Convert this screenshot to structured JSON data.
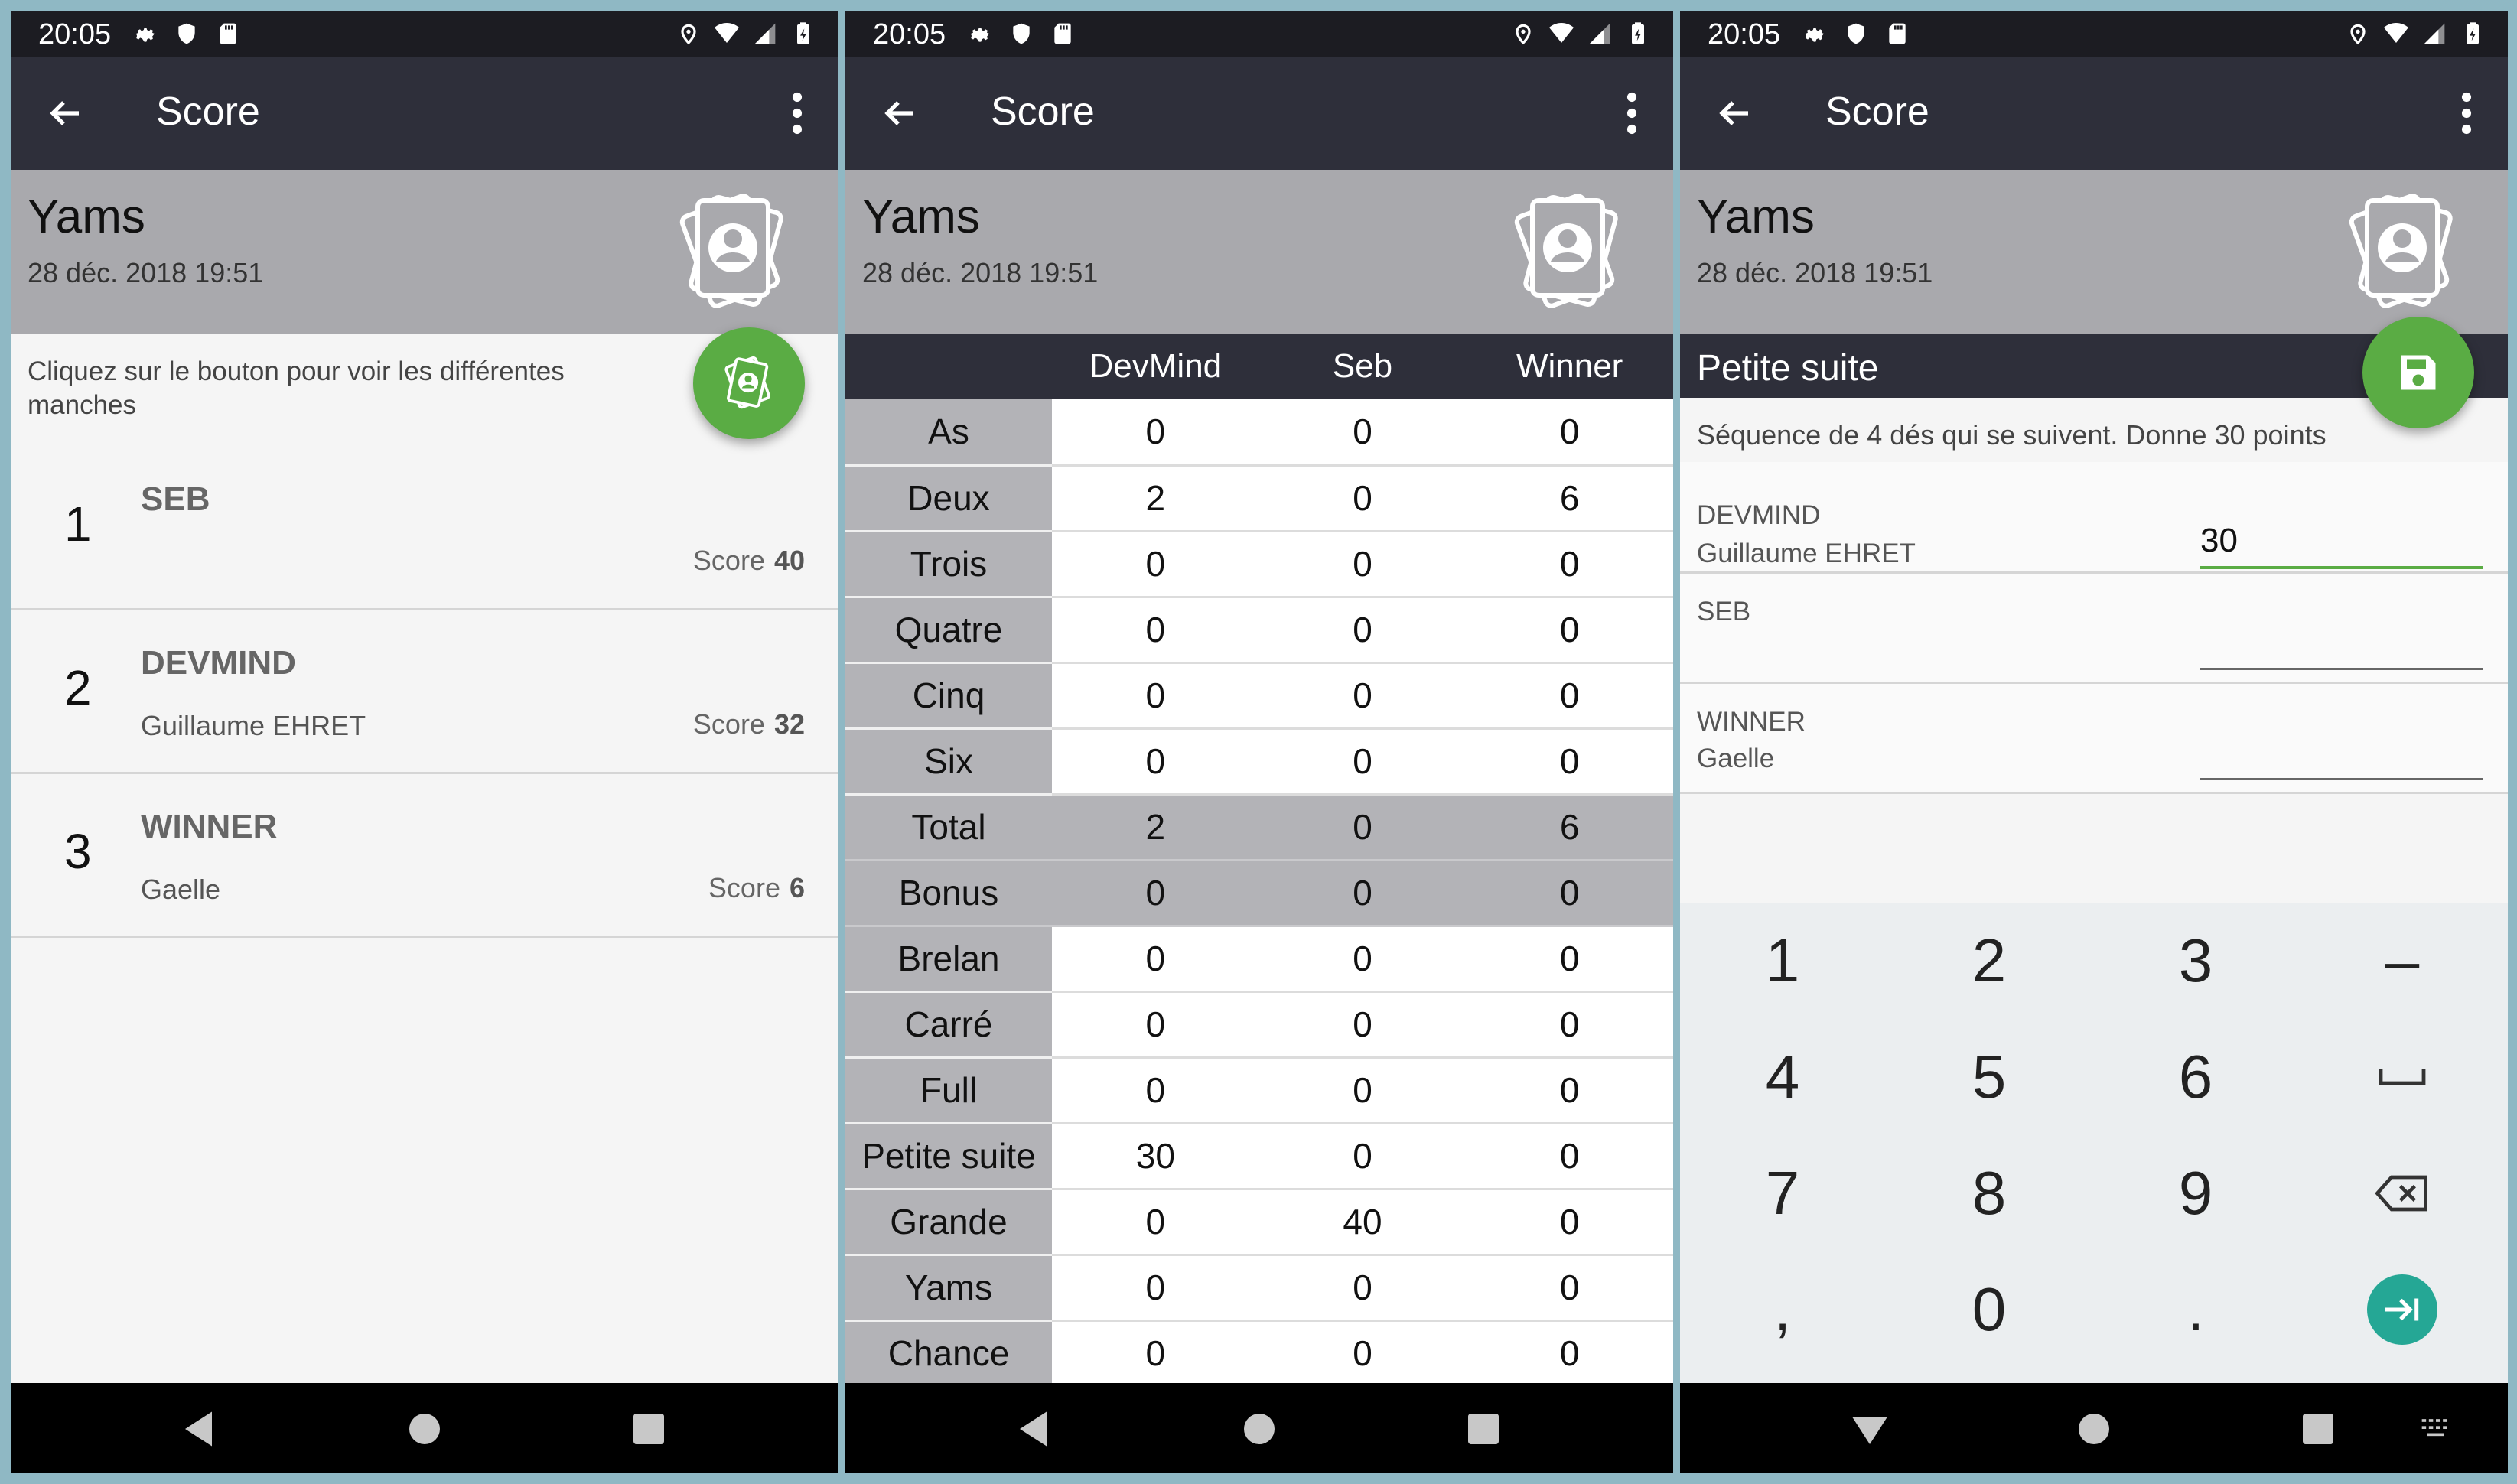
{
  "status": {
    "time": "20:05"
  },
  "appbar": {
    "title": "Score"
  },
  "game": {
    "name": "Yams",
    "date": "28 déc. 2018 19:51"
  },
  "ranking": {
    "hint": "Cliquez sur le bouton pour voir les différentes manches",
    "score_label": "Score",
    "items": [
      {
        "rank": "1",
        "name": "SEB",
        "subtitle": "",
        "score": "40"
      },
      {
        "rank": "2",
        "name": "DEVMIND",
        "subtitle": "Guillaume EHRET",
        "score": "32"
      },
      {
        "rank": "3",
        "name": "WINNER",
        "subtitle": "Gaelle",
        "score": "6"
      }
    ]
  },
  "table": {
    "headers": [
      "",
      "DevMind",
      "Seb",
      "Winner"
    ],
    "rows": [
      {
        "label": "As",
        "values": [
          "0",
          "0",
          "0"
        ]
      },
      {
        "label": "Deux",
        "values": [
          "2",
          "0",
          "6"
        ]
      },
      {
        "label": "Trois",
        "values": [
          "0",
          "0",
          "0"
        ]
      },
      {
        "label": "Quatre",
        "values": [
          "0",
          "0",
          "0"
        ]
      },
      {
        "label": "Cinq",
        "values": [
          "0",
          "0",
          "0"
        ]
      },
      {
        "label": "Six",
        "values": [
          "0",
          "0",
          "0"
        ]
      },
      {
        "label": "Total",
        "values": [
          "2",
          "0",
          "6"
        ]
      },
      {
        "label": "Bonus",
        "values": [
          "0",
          "0",
          "0"
        ]
      },
      {
        "label": "Brelan",
        "values": [
          "0",
          "0",
          "0"
        ]
      },
      {
        "label": "Carré",
        "values": [
          "0",
          "0",
          "0"
        ]
      },
      {
        "label": "Full",
        "values": [
          "0",
          "0",
          "0"
        ]
      },
      {
        "label": "Petite suite",
        "values": [
          "30",
          "0",
          "0"
        ]
      },
      {
        "label": "Grande",
        "values": [
          "0",
          "40",
          "0"
        ]
      },
      {
        "label": "Yams",
        "values": [
          "0",
          "0",
          "0"
        ]
      },
      {
        "label": "Chance",
        "values": [
          "0",
          "0",
          "0"
        ]
      }
    ]
  },
  "entry": {
    "category": "Petite suite",
    "description": "Séquence de 4 dés qui se suivent. Donne 30 points",
    "players": [
      {
        "name": "DEVMIND",
        "label": "Guillaume EHRET",
        "value": "30"
      },
      {
        "name": "SEB",
        "label": "",
        "value": ""
      },
      {
        "name": "WINNER",
        "label": "Gaelle",
        "value": ""
      }
    ]
  },
  "keypad": {
    "keys": [
      "1",
      "2",
      "3",
      "–",
      "4",
      "5",
      "6",
      "",
      "7",
      "8",
      "9",
      "",
      ",",
      "0",
      ".",
      ""
    ]
  },
  "colors": {
    "accent": "#5aac44",
    "appbar": "#2e2f3a",
    "header": "#a9a9ad",
    "teal": "#25a795"
  }
}
